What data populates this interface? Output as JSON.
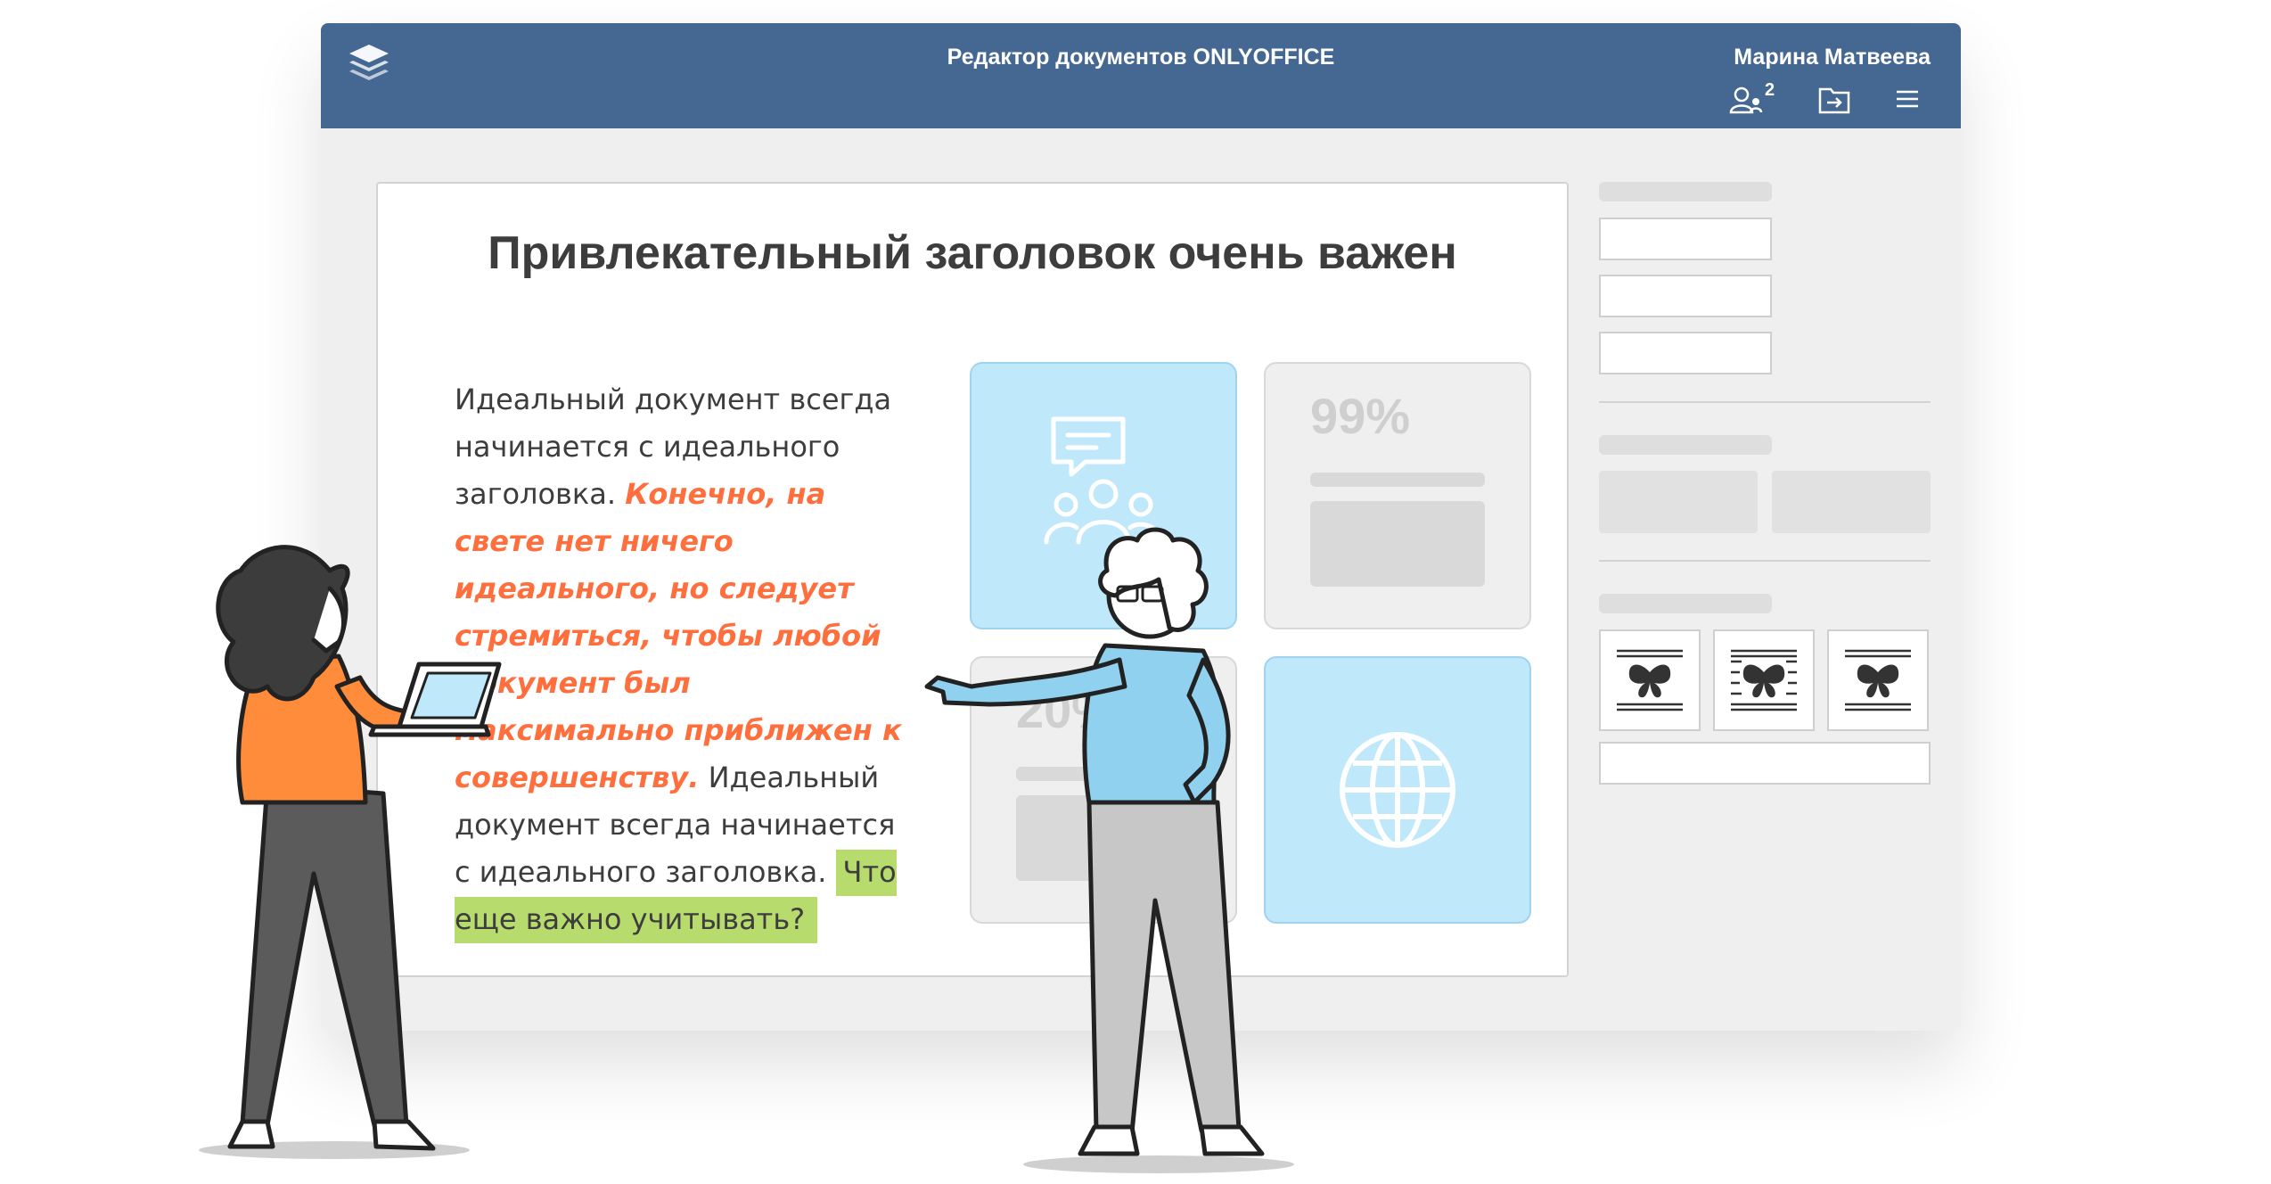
{
  "header": {
    "app_title": "Редактор документов ONLYOFFICE",
    "user_name": "Марина Матвеева",
    "coauthors_count": "2",
    "icons": [
      "logo-layers-icon",
      "users-icon",
      "open-location-icon",
      "menu-icon"
    ]
  },
  "document": {
    "title": "Привлекательный заголовок очень важен",
    "paragraph": {
      "part1": "Идеальный документ всегда начинается с идеального заголовка. ",
      "accent": "Конечно, на свете нет ничего идеального, но следует стремиться, чтобы любой документ был максимально приближен к совершенству.",
      "part2": " Идеальный документ всегда начинается с идеального заголовка. ",
      "highlight": "Что еще важно учитывать?"
    },
    "cards": [
      {
        "type": "icon",
        "icon": "chat-people-icon"
      },
      {
        "type": "stat",
        "value": "99%"
      },
      {
        "type": "stat",
        "value": "20%"
      },
      {
        "type": "icon",
        "icon": "globe-icon"
      }
    ]
  },
  "colors": {
    "header": "#456893",
    "accent": "#ff6f3d",
    "highlight": "#b8db6e",
    "card_blue": "#bfe9fb"
  }
}
